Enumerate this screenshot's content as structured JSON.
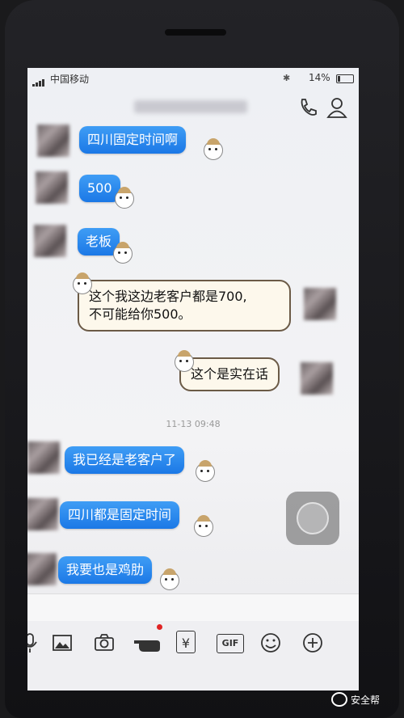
{
  "status_bar": {
    "carrier": "中国移动",
    "time": "",
    "battery": "14%",
    "battery_level": 0.14
  },
  "nav": {
    "contact_name": ""
  },
  "messages": [
    {
      "text": "四川固定时间啊"
    },
    {
      "text": "500"
    },
    {
      "text": "老板"
    },
    {
      "text_line1": "这个我这边老客户都是700,",
      "text_line2": "不可能给你500。"
    },
    {
      "text": "这个是实在话"
    },
    {
      "timestamp": "11-13 09:48"
    },
    {
      "text": "我已经是老客户了"
    },
    {
      "text": "四川都是固定时间"
    },
    {
      "text": "我要也是鸡肋"
    }
  ],
  "toolbar": {
    "icons": [
      "microphone-icon",
      "image-icon",
      "camera-icon",
      "hand-gesture-icon",
      "red-packet-icon",
      "gif-icon",
      "emoji-icon",
      "plus-icon"
    ],
    "red_packet_glyph": "¥",
    "gif_label": "GIF"
  },
  "watermark": {
    "text": "安全帮"
  },
  "colors": {
    "bubble_blue": "#2b88ee",
    "bubble_white_border": "#6b5a46",
    "notification_dot": "#e02424"
  }
}
